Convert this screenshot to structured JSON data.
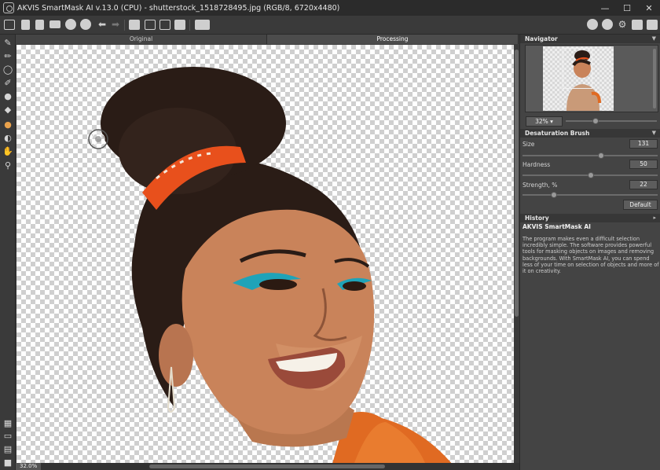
{
  "window": {
    "title": "AKVIS SmartMask AI v.13.0 (CPU) - shutterstock_1518728495.jpg (RGB/8, 6720x4480)",
    "minimize": "—",
    "maximize": "☐",
    "close": "✕"
  },
  "view_tabs": [
    "Original",
    "Processing"
  ],
  "status": {
    "zoom_label": "32.0%"
  },
  "navigator": {
    "title": "Navigator",
    "zoom_value": "32%"
  },
  "brush_panel": {
    "title": "Desaturation Brush",
    "params": [
      {
        "label": "Size",
        "value": "131",
        "level": 0.61
      },
      {
        "label": "Hardness",
        "value": "50",
        "level": 0.54
      },
      {
        "label": "Strength, %",
        "value": "22",
        "level": 0.22
      }
    ],
    "default_label": "Default"
  },
  "history": {
    "title": "History"
  },
  "help": {
    "title": "AKVIS SmartMask AI",
    "text": "The program makes even a difficult selection incredibly simple. The software provides powerful tools for masking objects on images and removing backgrounds. With SmartMask AI, you can spend less of your time on selection of objects and more of it on creativity."
  },
  "colors": {
    "accent_orange": "#e9a24c",
    "panel_bg": "#444444",
    "headband_orange": "#e8501c",
    "skin": "#c9835a",
    "hair": "#2a1c16",
    "teal_eyeliner": "#1fa3b8"
  },
  "icons": {
    "toolbar": [
      "open-icon",
      "save-icon",
      "export-icon",
      "print-icon",
      "load-preset-icon",
      "save-preset-icon",
      "undo-icon",
      "redo-icon",
      "run-icon",
      "adjust-icon",
      "batch-icon",
      "layers-icon",
      "mode-icon",
      "about-icon",
      "help-icon",
      "settings-icon",
      "export-pass-icon",
      "notify-icon"
    ],
    "tools": [
      "magic-brush-icon",
      "pencil-icon",
      "lasso-icon",
      "select-brush-icon",
      "drop-icon",
      "eraser-icon",
      "desaturation-brush-icon",
      "color-range-icon",
      "hand-icon",
      "zoom-icon",
      "transparency-icon",
      "background-icon",
      "select-all-icon",
      "mask-icon"
    ]
  }
}
